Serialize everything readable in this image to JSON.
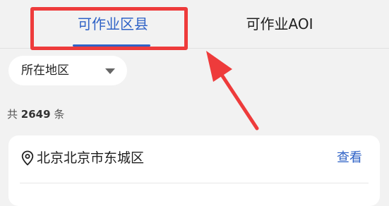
{
  "tabs": {
    "active_label": "可作业区县",
    "inactive_label": "可作业AOI"
  },
  "filter": {
    "region_label": "所在地区"
  },
  "summary": {
    "prefix": "共",
    "count": "2649",
    "suffix": "条"
  },
  "list": {
    "items": [
      {
        "title": "北京北京市东城区",
        "action": "查看"
      }
    ]
  },
  "colors": {
    "accent": "#2f62c6",
    "annotation": "#ee3b3b",
    "background": "#f2f2f2"
  },
  "icons": {
    "location": "map-pin-icon",
    "dropdown": "caret-down-icon"
  }
}
